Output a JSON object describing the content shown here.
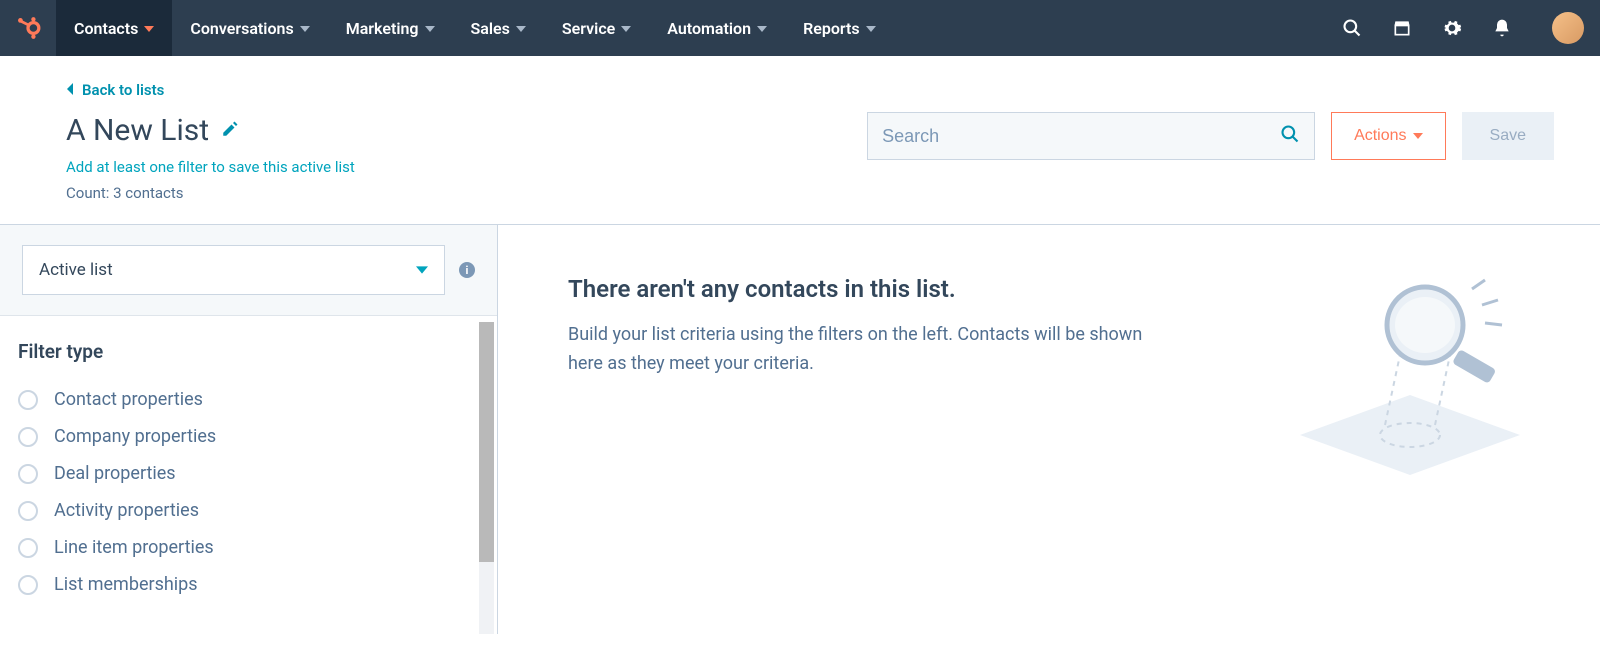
{
  "nav": {
    "items": [
      {
        "label": "Contacts",
        "active": true
      },
      {
        "label": "Conversations",
        "active": false
      },
      {
        "label": "Marketing",
        "active": false
      },
      {
        "label": "Sales",
        "active": false
      },
      {
        "label": "Service",
        "active": false
      },
      {
        "label": "Automation",
        "active": false
      },
      {
        "label": "Reports",
        "active": false
      }
    ]
  },
  "header": {
    "back_label": "Back to lists",
    "title": "A New List",
    "hint": "Add at least one filter to save this active list",
    "count_text": "Count: 3 contacts",
    "search_placeholder": "Search",
    "actions_label": "Actions",
    "save_label": "Save"
  },
  "sidebar": {
    "list_type": "Active list",
    "filter_heading": "Filter type",
    "filters": [
      "Contact properties",
      "Company properties",
      "Deal properties",
      "Activity properties",
      "Line item properties",
      "List memberships"
    ]
  },
  "empty": {
    "title": "There aren't any contacts in this list.",
    "desc": "Build your list criteria using the filters on the left. Contacts will be shown here as they meet your criteria."
  }
}
